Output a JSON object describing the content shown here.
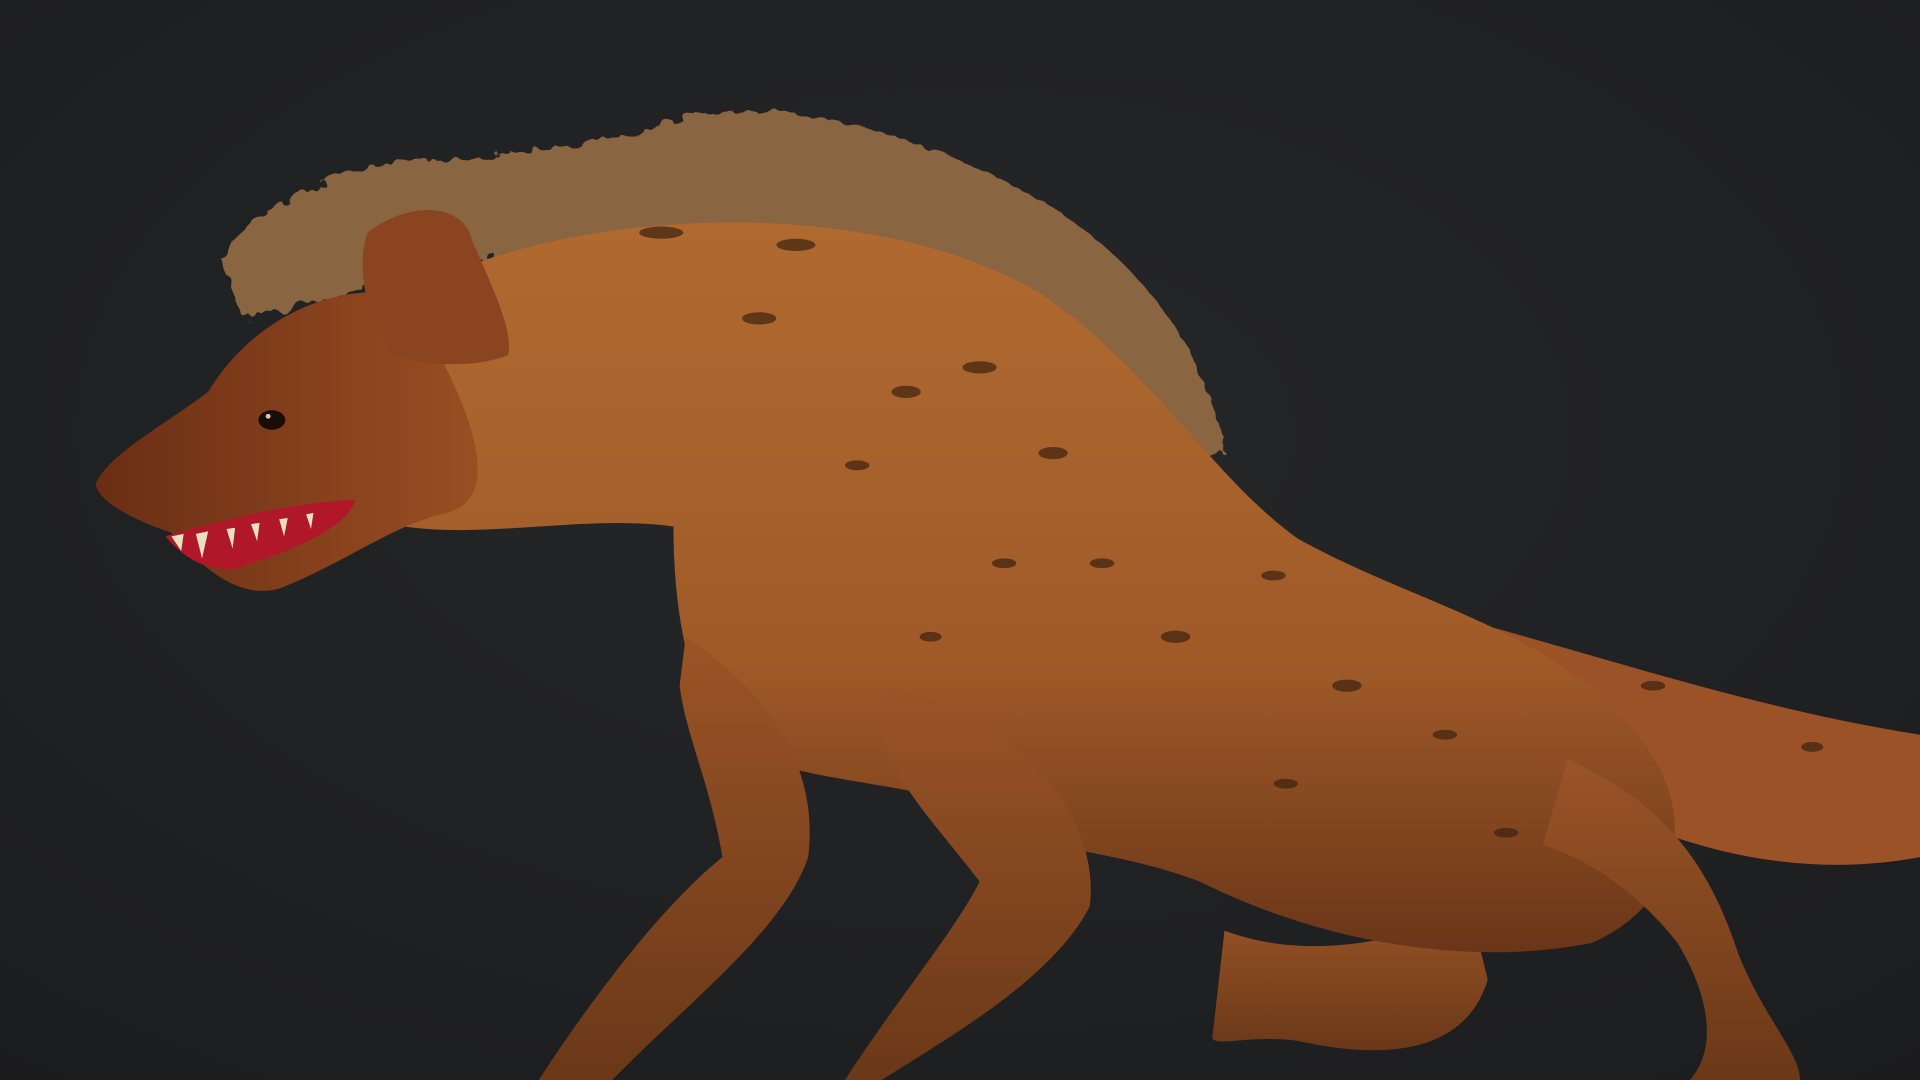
{
  "scene": {
    "subject": "hyena",
    "colors": {
      "background": "#1f2022",
      "fur": "#a8642e",
      "fur_dark": "#6e3a1a",
      "mane": "#8a6542",
      "mouth": "#b0182a",
      "teeth": "#e8e0c0",
      "spots": "#3c2210"
    }
  }
}
